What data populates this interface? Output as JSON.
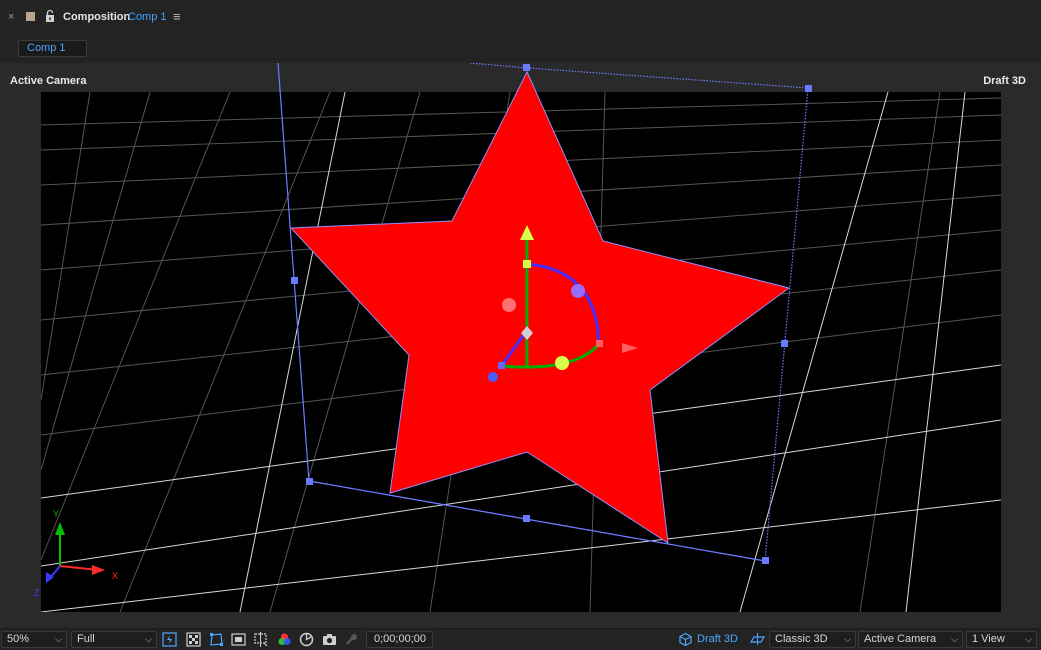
{
  "panel": {
    "close_glyph": "×",
    "title": "Composition",
    "comp_name": "Comp 1",
    "menu_glyph": "≡"
  },
  "tabs": [
    {
      "label": "Comp 1"
    }
  ],
  "viewer": {
    "camera_label": "Active Camera",
    "renderer_label": "Draft 3D",
    "axis_labels": {
      "y": "Y",
      "x": "X",
      "z": "Z"
    }
  },
  "colors": {
    "star_fill": "#ff0000",
    "bounding_box": "#6b7bff",
    "accent": "#4da6ff",
    "y_axis": "#00c000",
    "x_axis": "#ff2a2a",
    "z_axis": "#3a3aff",
    "y_cone": "#d8ff4a"
  },
  "footer": {
    "zoom": {
      "value": "50%"
    },
    "resolution": {
      "value": "Full"
    },
    "icons": [
      "fast-previews-icon",
      "transparency-grid-icon",
      "mask-path-icon",
      "region-of-interest-icon",
      "guides-icon",
      "rgb-channels-icon",
      "exposure-reset-icon",
      "snapshot-icon",
      "show-snapshot-icon"
    ],
    "timecode": "0;00;00;00",
    "draft3d_label": "Draft 3D",
    "renderer": {
      "value": "Classic 3D"
    },
    "camera": {
      "value": "Active Camera"
    },
    "views": {
      "value": "1 View"
    }
  }
}
